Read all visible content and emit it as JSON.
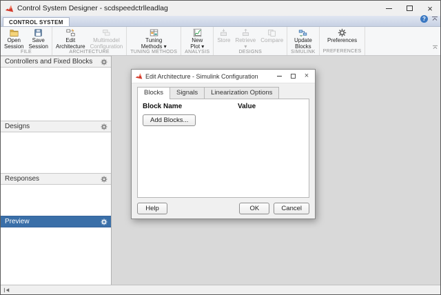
{
  "titlebar": {
    "title": "Control System Designer - scdspeedctrlleadlag"
  },
  "ribbon": {
    "tab": "CONTROL SYSTEM",
    "sections": [
      {
        "label": "FILE",
        "buttons": [
          {
            "label": "Open\nSession"
          },
          {
            "label": "Save\nSession"
          }
        ]
      },
      {
        "label": "ARCHITECTURE",
        "buttons": [
          {
            "label": "Edit\nArchitecture"
          },
          {
            "label": "Multimodel\nConfiguration",
            "disabled": true
          }
        ]
      },
      {
        "label": "TUNING METHODS",
        "buttons": [
          {
            "label": "Tuning\nMethods ▾"
          }
        ]
      },
      {
        "label": "ANALYSIS",
        "buttons": [
          {
            "label": "New\nPlot ▾"
          }
        ]
      },
      {
        "label": "DESIGNS",
        "buttons": [
          {
            "label": "Store",
            "disabled": true
          },
          {
            "label": "Retrieve\n▾",
            "disabled": true
          },
          {
            "label": "Compare",
            "disabled": true
          }
        ]
      },
      {
        "label": "SIMULINK",
        "buttons": [
          {
            "label": "Update\nBlocks"
          }
        ]
      },
      {
        "label": "PREFERENCES",
        "buttons": [
          {
            "label": "Preferences"
          }
        ]
      }
    ]
  },
  "sidebar": {
    "panels": [
      {
        "title": "Controllers and Fixed Blocks",
        "selected": false
      },
      {
        "title": "Designs",
        "selected": false
      },
      {
        "title": "Responses",
        "selected": false
      },
      {
        "title": "Preview",
        "selected": true
      }
    ]
  },
  "dialog": {
    "title": "Edit Architecture - Simulink Configuration",
    "tabs": [
      {
        "label": "Blocks",
        "active": true
      },
      {
        "label": "Signals",
        "active": false
      },
      {
        "label": "Linearization Options",
        "active": false
      }
    ],
    "columns": {
      "name": "Block Name",
      "value": "Value"
    },
    "buttons": {
      "add_blocks": "Add Blocks...",
      "help": "Help",
      "ok": "OK",
      "cancel": "Cancel"
    }
  },
  "icons": {
    "help_glyph": "?",
    "close_glyph": "×"
  },
  "colors": {
    "selected_panel_header": "#3a6fa8",
    "tabstrip_bg": "#cfd8e8",
    "main_bg": "#d9d9d9",
    "disabled_text": "#b0b0b0"
  }
}
